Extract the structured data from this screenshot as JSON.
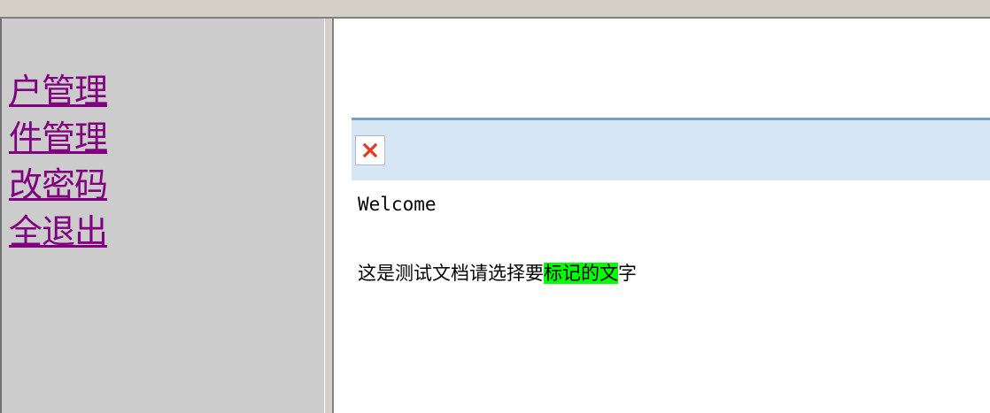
{
  "nav": {
    "items": [
      {
        "label": "户管理"
      },
      {
        "label": "件管理"
      },
      {
        "label": "改密码"
      },
      {
        "label": "全退出"
      }
    ]
  },
  "tab": {
    "close_icon": "close-icon",
    "close_color": "#e8381d"
  },
  "content": {
    "welcome": "Welcome",
    "doc_text_before": "这是测试文档请选择要",
    "doc_text_highlighted": "标记的文",
    "doc_text_after": "字",
    "highlight_color": "#00ff00"
  }
}
